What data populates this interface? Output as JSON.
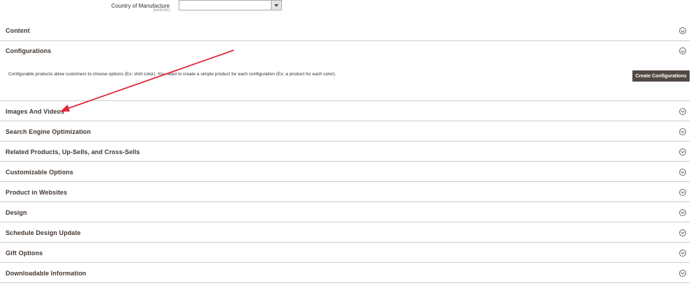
{
  "country_field": {
    "label": "Country of Manufacture",
    "scope": "[website]",
    "value": ""
  },
  "sections": [
    {
      "id": "content",
      "title": "Content",
      "expanded": false
    },
    {
      "id": "configurations",
      "title": "Configurations",
      "expanded": true,
      "description": "Configurable products allow customers to choose options (Ex: shirt color). You need to create a simple product for each configuration (Ex: a product for each color).",
      "button_label": "Create Configurations"
    },
    {
      "id": "images-and-videos",
      "title": "Images And Videos",
      "expanded": false
    },
    {
      "id": "seo",
      "title": "Search Engine Optimization",
      "expanded": false
    },
    {
      "id": "related-products",
      "title": "Related Products, Up-Sells, and Cross-Sells",
      "expanded": false
    },
    {
      "id": "customizable-options",
      "title": "Customizable Options",
      "expanded": false
    },
    {
      "id": "product-in-websites",
      "title": "Product in Websites",
      "expanded": false
    },
    {
      "id": "design",
      "title": "Design",
      "expanded": false
    },
    {
      "id": "schedule-design-update",
      "title": "Schedule Design Update",
      "expanded": false
    },
    {
      "id": "gift-options",
      "title": "Gift Options",
      "expanded": false
    },
    {
      "id": "downloadable-information",
      "title": "Downloadable Information",
      "expanded": false
    }
  ],
  "icons": {
    "toggle": "chevron-circle-icon",
    "select_arrow": "caret-down-icon"
  },
  "colors": {
    "button_bg": "#514943",
    "annotation": "#e22a3f"
  }
}
